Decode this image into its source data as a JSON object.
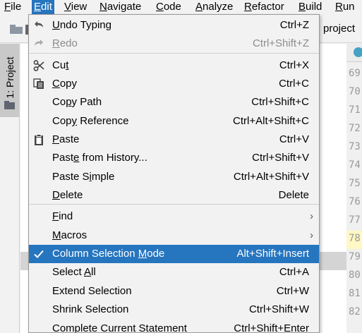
{
  "menubar": {
    "items": [
      {
        "label": "File",
        "mnemonic_index": 0
      },
      {
        "label": "Edit",
        "mnemonic_index": 0
      },
      {
        "label": "View",
        "mnemonic_index": 0
      },
      {
        "label": "Navigate",
        "mnemonic_index": 0
      },
      {
        "label": "Code",
        "mnemonic_index": 0
      },
      {
        "label": "Analyze",
        "mnemonic_index": 0
      },
      {
        "label": "Refactor",
        "mnemonic_index": 0
      },
      {
        "label": "Build",
        "mnemonic_index": 0
      },
      {
        "label": "Run",
        "mnemonic_index": 0
      }
    ],
    "active_label": "Edit"
  },
  "navbar": {
    "project_label": "project"
  },
  "toolstrip": {
    "project_tab_label": "1: Project"
  },
  "editor": {
    "line_numbers": [
      "69",
      "70",
      "71",
      "72",
      "73",
      "74",
      "75",
      "76",
      "77",
      "78",
      "79",
      "80",
      "81",
      "82"
    ],
    "highlighted_line": "78"
  },
  "edit_menu": {
    "items": [
      {
        "pre": "",
        "mn": "U",
        "post": "ndo Typing",
        "shortcut": "Ctrl+Z",
        "icon": "undo-icon",
        "disabled": false
      },
      {
        "pre": "",
        "mn": "R",
        "post": "edo",
        "shortcut": "Ctrl+Shift+Z",
        "icon": "redo-icon",
        "disabled": true
      },
      {
        "pre": "Cu",
        "mn": "t",
        "post": "",
        "shortcut": "Ctrl+X",
        "icon": "cut-icon",
        "disabled": false
      },
      {
        "pre": "",
        "mn": "C",
        "post": "opy",
        "shortcut": "Ctrl+C",
        "icon": "copy-icon",
        "disabled": false
      },
      {
        "pre": "Co",
        "mn": "p",
        "post": "y Path",
        "shortcut": "Ctrl+Shift+C",
        "icon": "",
        "disabled": false
      },
      {
        "pre": "Cop",
        "mn": "y",
        "post": " Reference",
        "shortcut": "Ctrl+Alt+Shift+C",
        "icon": "",
        "disabled": false
      },
      {
        "pre": "",
        "mn": "P",
        "post": "aste",
        "shortcut": "Ctrl+V",
        "icon": "paste-icon",
        "disabled": false
      },
      {
        "pre": "Past",
        "mn": "e",
        "post": " from History...",
        "shortcut": "Ctrl+Shift+V",
        "icon": "",
        "disabled": false
      },
      {
        "pre": "Paste S",
        "mn": "i",
        "post": "mple",
        "shortcut": "Ctrl+Alt+Shift+V",
        "icon": "",
        "disabled": false
      },
      {
        "pre": "",
        "mn": "D",
        "post": "elete",
        "shortcut": "Delete",
        "icon": "",
        "disabled": false
      },
      {
        "pre": "",
        "mn": "F",
        "post": "ind",
        "shortcut": "",
        "submenu": "›",
        "icon": "",
        "disabled": false
      },
      {
        "pre": "",
        "mn": "M",
        "post": "acros",
        "shortcut": "",
        "submenu": "›",
        "icon": "",
        "disabled": false
      },
      {
        "pre": "Column Selection ",
        "mn": "M",
        "post": "ode",
        "shortcut": "Alt+Shift+Insert",
        "icon": "check-icon",
        "disabled": false,
        "selected": true
      },
      {
        "pre": "Select ",
        "mn": "A",
        "post": "ll",
        "shortcut": "Ctrl+A",
        "icon": "",
        "disabled": false
      },
      {
        "pre": "Extend Selection",
        "mn": "",
        "post": "",
        "shortcut": "Ctrl+W",
        "icon": "",
        "disabled": false
      },
      {
        "pre": "Shrink Selection",
        "mn": "",
        "post": "",
        "shortcut": "Ctrl+Shift+W",
        "icon": "",
        "disabled": false
      },
      {
        "pre": "Complete Current Statement",
        "mn": "",
        "post": "",
        "shortcut": "Ctrl+Shift+Enter",
        "icon": "",
        "disabled": false
      }
    ]
  },
  "colors": {
    "selection": "#2675bf",
    "menu_bg": "#f2f2f2",
    "disabled_text": "#8c8c8c",
    "gutter_text": "#999999"
  }
}
